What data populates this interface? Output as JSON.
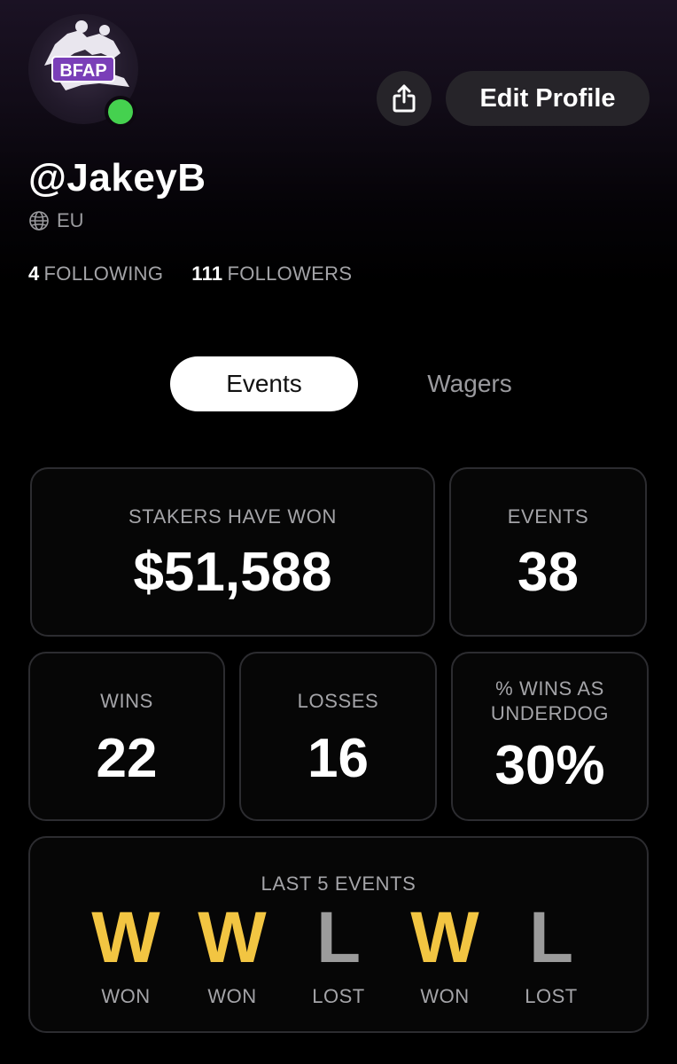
{
  "profile": {
    "avatar_text": "BFAP",
    "username": "@JakeyB",
    "region": "EU",
    "following_count": "4",
    "following_label": "FOLLOWING",
    "followers_count": "111",
    "followers_label": "FOLLOWERS",
    "online_color": "#45d14f"
  },
  "header": {
    "share_icon": "share-icon",
    "edit_label": "Edit Profile"
  },
  "tabs": [
    {
      "label": "Events",
      "active": true
    },
    {
      "label": "Wagers",
      "active": false
    }
  ],
  "stats": {
    "stakers_label": "STAKERS HAVE WON",
    "stakers_value": "$51,588",
    "events_label": "EVENTS",
    "events_value": "38",
    "wins_label": "WINS",
    "wins_value": "22",
    "losses_label": "LOSSES",
    "losses_value": "16",
    "underdog_label_line1": "% WINS AS",
    "underdog_label_line2": "UNDERDOG",
    "underdog_value": "30%"
  },
  "last5": {
    "label": "LAST 5 EVENTS",
    "results": [
      {
        "letter": "W",
        "text": "WON",
        "outcome": "win"
      },
      {
        "letter": "W",
        "text": "WON",
        "outcome": "win"
      },
      {
        "letter": "L",
        "text": "LOST",
        "outcome": "loss"
      },
      {
        "letter": "W",
        "text": "WON",
        "outcome": "win"
      },
      {
        "letter": "L",
        "text": "LOST",
        "outcome": "loss"
      }
    ],
    "win_color": "#f2c542",
    "loss_color": "#9b9b9b"
  }
}
